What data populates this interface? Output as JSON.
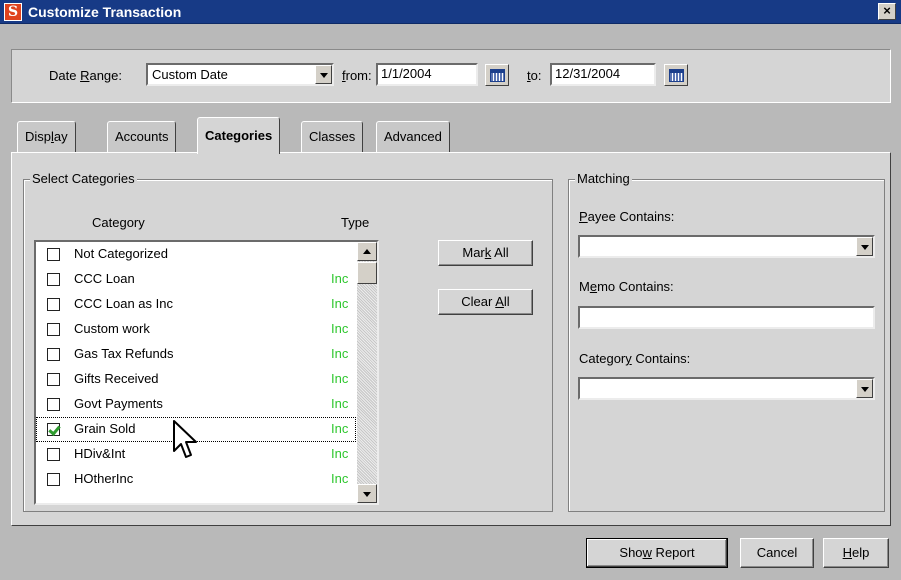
{
  "window": {
    "title": "Customize Transaction",
    "close_label": "×"
  },
  "date_range": {
    "label_pre": "Date ",
    "label_key": "R",
    "label_post": "ange:",
    "value": "Custom Date",
    "from_label_key": "f",
    "from_label_post": "rom:",
    "from_value": "1/1/2004",
    "to_label_key": "t",
    "to_label_post": "o:",
    "to_value": "12/31/2004"
  },
  "tabs": [
    {
      "pre": "Disp",
      "key": "l",
      "post": "ay"
    },
    {
      "pre": "Accounts",
      "key": "",
      "post": ""
    },
    {
      "pre": "Categories",
      "key": "",
      "post": ""
    },
    {
      "pre": "Classes",
      "key": "",
      "post": ""
    },
    {
      "pre": "Advanced",
      "key": "",
      "post": ""
    }
  ],
  "select_categories": {
    "group_label": "Select Categories",
    "col_category": "Category",
    "col_type": "Type",
    "rows": [
      {
        "name": "Not Categorized",
        "type": "",
        "checked": false
      },
      {
        "name": "CCC Loan",
        "type": "Inc",
        "checked": false
      },
      {
        "name": "CCC Loan as Inc",
        "type": "Inc",
        "checked": false
      },
      {
        "name": "Custom work",
        "type": "Inc",
        "checked": false
      },
      {
        "name": "Gas Tax Refunds",
        "type": "Inc",
        "checked": false
      },
      {
        "name": "Gifts Received",
        "type": "Inc",
        "checked": false
      },
      {
        "name": "Govt Payments",
        "type": "Inc",
        "checked": false
      },
      {
        "name": "Grain Sold",
        "type": "Inc",
        "checked": true
      },
      {
        "name": "HDiv&Int",
        "type": "Inc",
        "checked": false
      },
      {
        "name": "HOtherInc",
        "type": "Inc",
        "checked": false
      }
    ],
    "mark_all": {
      "pre": "Mar",
      "key": "k",
      "post": " All"
    },
    "clear_all": {
      "pre": "Clear ",
      "key": "A",
      "post": "ll"
    }
  },
  "matching": {
    "group_label": "Matching",
    "payee": {
      "pre": "",
      "key": "P",
      "post": "ayee Contains:",
      "value": ""
    },
    "memo": {
      "pre": "M",
      "key": "e",
      "post": "mo Contains:",
      "value": ""
    },
    "category": {
      "pre": "Categor",
      "key": "y",
      "post": " Contains:",
      "value": ""
    }
  },
  "footer": {
    "show_report": {
      "pre": "Sho",
      "key": "w",
      "post": " Report"
    },
    "cancel": "Cancel",
    "help": {
      "pre": "",
      "key": "H",
      "post": "elp"
    }
  },
  "colors": {
    "titlebar": "#173a86",
    "type_text": "#2ec72e",
    "checkmark": "#2e9b2e"
  }
}
